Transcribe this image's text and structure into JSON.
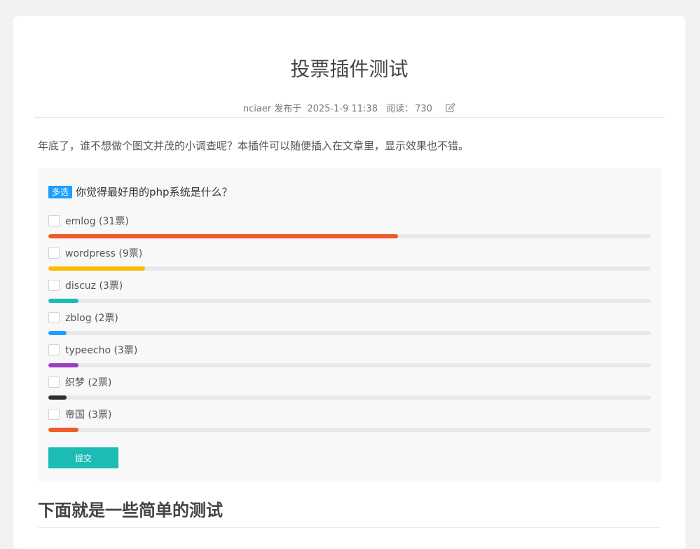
{
  "article": {
    "title": "投票插件测试",
    "author": "nciaer",
    "published_label": "发布于",
    "date": "2025-1-9 11:38",
    "views_label": "阅读：",
    "views": "730",
    "intro": "年底了，谁不想做个图文并茂的小调查呢？本插件可以随便插入在文章里，显示效果也不错。",
    "section_heading": "下面就是一些简单的测试"
  },
  "poll": {
    "badge": "多选",
    "question": "你觉得最好用的php系统是什么？",
    "submit_label": "提交",
    "options": [
      {
        "label": "emlog (31票)",
        "votes": 31,
        "fill_fraction": 0.58,
        "color": "#f05a28"
      },
      {
        "label": "wordpress (9票)",
        "votes": 9,
        "fill_fraction": 0.16,
        "color": "#ffb800"
      },
      {
        "label": "discuz (3票)",
        "votes": 3,
        "fill_fraction": 0.05,
        "color": "#1cbbb4"
      },
      {
        "label": "zblog (2票)",
        "votes": 2,
        "fill_fraction": 0.03,
        "color": "#1e9fff"
      },
      {
        "label": "typeecho (3票)",
        "votes": 3,
        "fill_fraction": 0.05,
        "color": "#9c3dc8"
      },
      {
        "label": "织梦 (2票)",
        "votes": 2,
        "fill_fraction": 0.03,
        "color": "#2f2f2f"
      },
      {
        "label": "帝国 (3票)",
        "votes": 3,
        "fill_fraction": 0.05,
        "color": "#f05a28"
      }
    ]
  },
  "icons": {
    "edit": "edit-icon"
  }
}
